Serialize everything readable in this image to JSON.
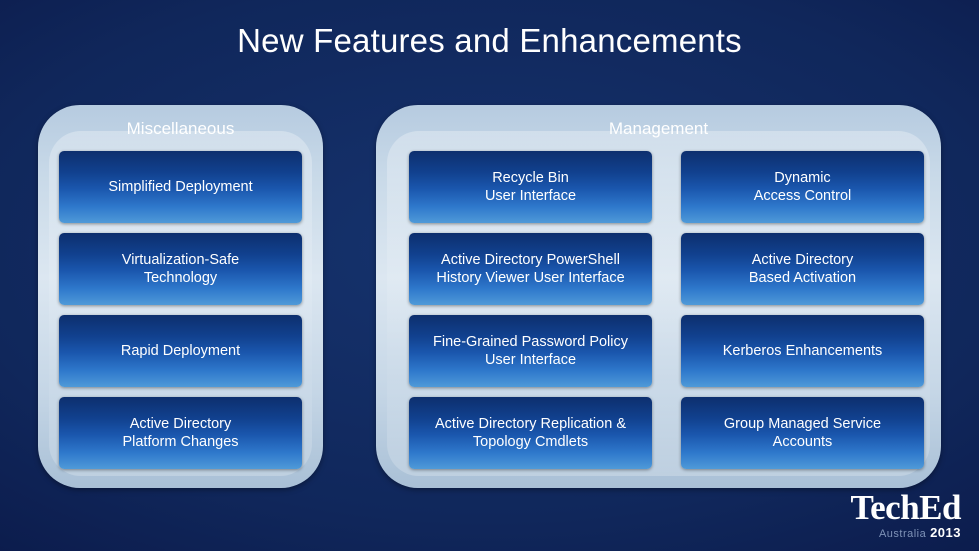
{
  "slide": {
    "title": "New Features and Enhancements"
  },
  "groups": [
    {
      "id": "misc",
      "label": "Miscellaneous",
      "cards": [
        {
          "lines": [
            "Simplified Deployment"
          ]
        },
        {
          "lines": [
            "Virtualization-Safe",
            "Technology"
          ]
        },
        {
          "lines": [
            "Rapid Deployment"
          ]
        },
        {
          "lines": [
            "Active Directory",
            "Platform Changes"
          ]
        }
      ]
    },
    {
      "id": "mgmt",
      "label": "Management",
      "cards_left": [
        {
          "lines": [
            "Recycle Bin",
            "User Interface"
          ]
        },
        {
          "lines": [
            "Active Directory PowerShell",
            "History Viewer User Interface"
          ]
        },
        {
          "lines": [
            "Fine-Grained Password Policy",
            "User Interface"
          ]
        },
        {
          "lines": [
            "Active Directory Replication &",
            "Topology Cmdlets"
          ]
        }
      ],
      "cards_right": [
        {
          "lines": [
            "Dynamic",
            "Access Control"
          ]
        },
        {
          "lines": [
            "Active Directory",
            "Based Activation"
          ]
        },
        {
          "lines": [
            "Kerberos Enhancements"
          ]
        },
        {
          "lines": [
            "Group Managed Service",
            "Accounts"
          ]
        }
      ]
    }
  ],
  "logo": {
    "main": "TechEd",
    "location": "Australia",
    "year": "2013"
  },
  "colors": {
    "background": "#10275b",
    "card_top": "#0d2f6e",
    "card_bottom": "#4f9ad8",
    "shell": "#c8d9e8",
    "text": "#ffffff"
  }
}
